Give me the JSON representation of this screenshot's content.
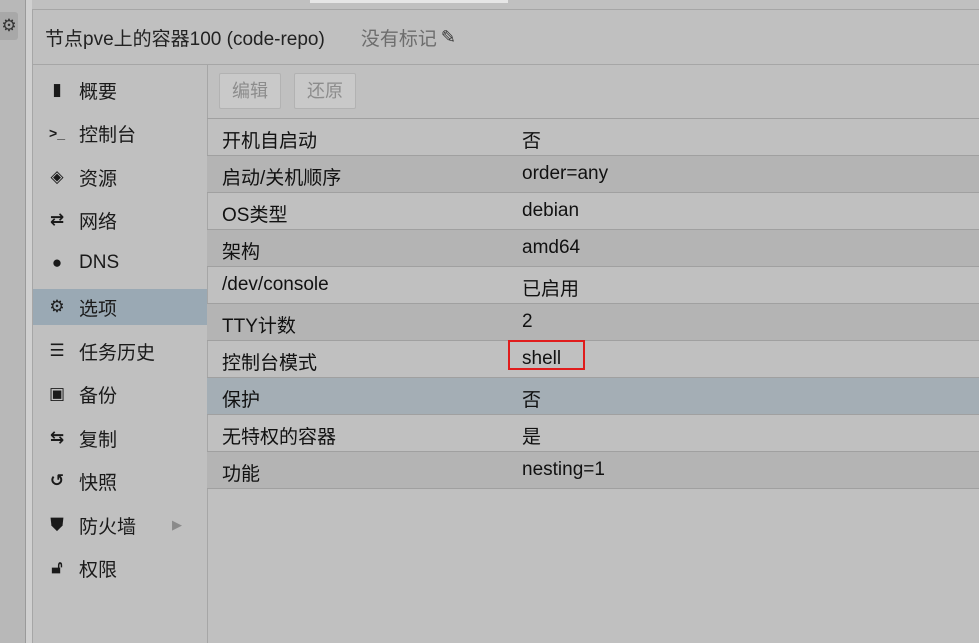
{
  "header": {
    "title": "节点pve上的容器100 (code-repo)",
    "tags_label": "没有标记",
    "tags_icon": "pencil-icon"
  },
  "nav": {
    "items": [
      {
        "label": "概要",
        "icon": "book-icon"
      },
      {
        "label": "控制台",
        "icon": "terminal-icon"
      },
      {
        "label": "资源",
        "icon": "cube-icon"
      },
      {
        "label": "网络",
        "icon": "exchange-icon"
      },
      {
        "label": "DNS",
        "icon": "globe-icon"
      },
      {
        "label": "选项",
        "icon": "gear-icon",
        "active": true
      },
      {
        "label": "任务历史",
        "icon": "list-icon"
      },
      {
        "label": "备份",
        "icon": "floppy-icon"
      },
      {
        "label": "复制",
        "icon": "retweet-icon"
      },
      {
        "label": "快照",
        "icon": "history-icon"
      },
      {
        "label": "防火墙",
        "icon": "shield-icon",
        "expandable": true
      },
      {
        "label": "权限",
        "icon": "unlock-icon"
      }
    ]
  },
  "toolbar": {
    "edit_label": "编辑",
    "revert_label": "还原"
  },
  "options": {
    "rows": [
      {
        "key": "开机自启动",
        "value": "否"
      },
      {
        "key": "启动/关机顺序",
        "value": "order=any"
      },
      {
        "key": "OS类型",
        "value": "debian"
      },
      {
        "key": "架构",
        "value": "amd64"
      },
      {
        "key": "/dev/console",
        "value": "已启用"
      },
      {
        "key": "TTY计数",
        "value": "2"
      },
      {
        "key": "控制台模式",
        "value": "shell"
      },
      {
        "key": "保护",
        "value": "否"
      },
      {
        "key": "无特权的容器",
        "value": "是"
      },
      {
        "key": "功能",
        "value": "nesting=1"
      }
    ],
    "selected_row": "保护",
    "highlighted_value": "shell"
  },
  "colors": {
    "active_nav": "#9aa9b4",
    "selected_row": "#a4aeb5",
    "highlight_box": "#e01c1c"
  }
}
